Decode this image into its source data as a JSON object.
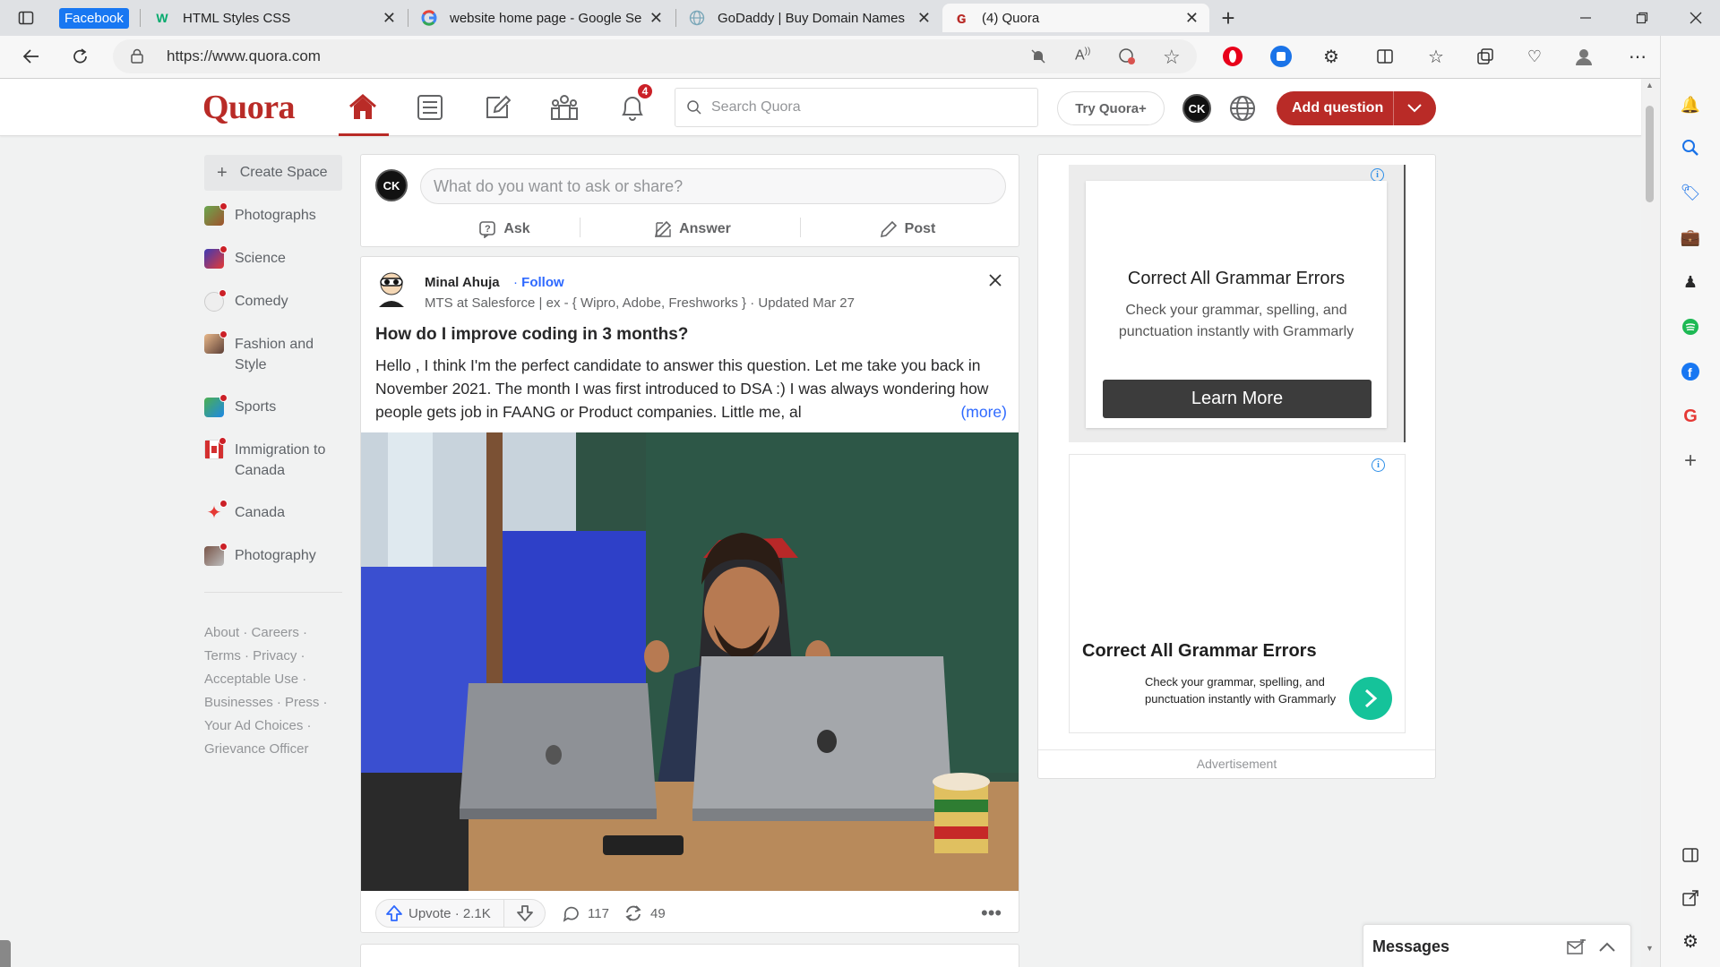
{
  "browser": {
    "tabs": [
      {
        "title": "Facebook",
        "badge": true
      },
      {
        "title": "HTML Styles CSS"
      },
      {
        "title": "website home page - Google Se"
      },
      {
        "title": "GoDaddy | Buy Domain Names"
      },
      {
        "title": "(4) Quora",
        "active": true
      }
    ],
    "url": "https://www.quora.com",
    "new_tab": "+"
  },
  "header": {
    "logo": "Quora",
    "notification_count": "4",
    "search_placeholder": "Search Quora",
    "try_plus": "Try Quora+",
    "avatar_text": "CK",
    "add_question": "Add question"
  },
  "sidebar": {
    "create_space": "Create Space",
    "items": [
      {
        "label": "Photographs",
        "color": "#6aa84f"
      },
      {
        "label": "Science",
        "color": "#3d3bb5"
      },
      {
        "label": "Comedy",
        "color": "#dddddd"
      },
      {
        "label": "Fashion and Style",
        "color": "#e8b88a"
      },
      {
        "label": "Sports",
        "color": "#4caf50"
      },
      {
        "label": "Immigration to Canada",
        "color": "#d32f2f"
      },
      {
        "label": "Canada",
        "color": "#e53935"
      },
      {
        "label": "Photography",
        "color": "#795548"
      }
    ],
    "footer": [
      "About · Careers ·",
      "Terms · Privacy ·",
      "Acceptable Use ·",
      "Businesses · Press ·",
      "Your Ad Choices ·",
      "Grievance Officer"
    ]
  },
  "composer": {
    "avatar_text": "CK",
    "placeholder": "What do you want to ask or share?",
    "ask": "Ask",
    "answer": "Answer",
    "post": "Post"
  },
  "post": {
    "author": "Minal Ahuja",
    "follow": "Follow",
    "credential": "MTS at Salesforce | ex - { Wipro, Adobe, Freshworks } · Updated Mar 27",
    "question": "How do I improve coding in 3 months?",
    "excerpt": "Hello , I think I'm the perfect candidate to answer this question. Let me take you back in November 2021. The month I was first introduced to DSA :) I was always wondering how people gets job in FAANG or Product companies. Little me, al",
    "more": "(more)",
    "upvote": "Upvote · 2.1K",
    "comments": "117",
    "shares": "49"
  },
  "ads": {
    "ad1_title": "Correct All Grammar Errors",
    "ad1_body": "Check your grammar, spelling, and punctuation instantly with Grammarly",
    "ad1_cta": "Learn More",
    "ad2_title": "Correct All Grammar Errors",
    "ad2_body": "Check your grammar, spelling, and punctuation instantly with Grammarly",
    "label": "Advertisement"
  },
  "messages": {
    "title": "Messages"
  },
  "colors": {
    "brand": "#b92b27",
    "link": "#2e69ff"
  }
}
